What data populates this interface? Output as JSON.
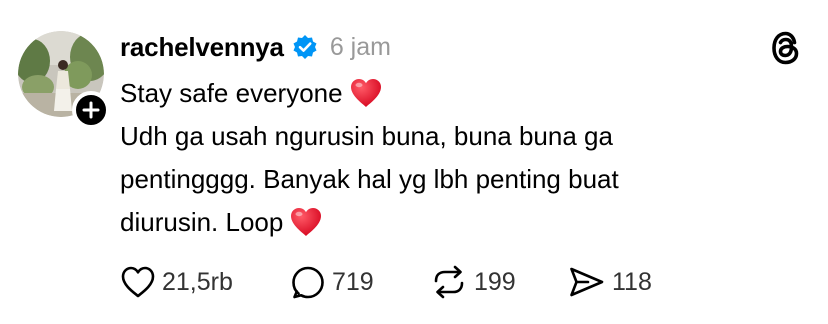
{
  "post": {
    "username": "rachelvennya",
    "verified": true,
    "timestamp": "6 jam",
    "lines": [
      "Stay safe everyone",
      "Udh ga usah ngurusin buna, buna buna ga",
      "pentingggg. Banyak hal yg lbh penting buat",
      "diurusin. Loop"
    ],
    "line_emojis": [
      "heart",
      null,
      null,
      "heart"
    ]
  },
  "actions": {
    "likes": "21,5rb",
    "replies": "719",
    "reposts": "199",
    "shares": "118"
  },
  "icons": {
    "follow": "plus-icon",
    "verified": "verified-badge-icon",
    "brand": "threads-logo-icon",
    "like": "heart-icon",
    "reply": "speech-bubble-icon",
    "repost": "repost-icon",
    "share": "send-icon"
  },
  "colors": {
    "verified_blue": "#0095f6",
    "heart_red": "#e0112b",
    "timestamp_gray": "#999999",
    "count_gray": "#333333"
  }
}
